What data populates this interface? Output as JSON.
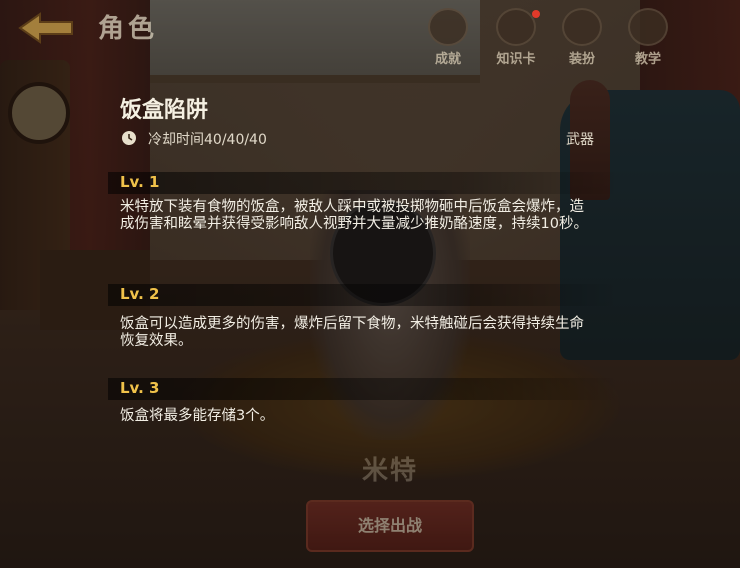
{
  "header": {
    "title": "角色",
    "buttons": [
      {
        "label": "成就",
        "icon": "trophy-icon"
      },
      {
        "label": "知识卡",
        "icon": "card-icon",
        "badge": true
      },
      {
        "label": "装扮",
        "icon": "outfit-icon"
      },
      {
        "label": "教学",
        "icon": "book-icon"
      }
    ]
  },
  "skill": {
    "name": "饭盒陷阱",
    "cooldown": "冷却时间40/40/40",
    "type": "武器",
    "levels": [
      {
        "label": "Lv. 1",
        "desc": "米特放下装有食物的饭盒，被敌人踩中或被投掷物砸中后饭盒会爆炸，造成伤害和眩晕并获得受影响敌人视野并大量减少推奶酪速度，持续10秒。"
      },
      {
        "label": "Lv. 2",
        "desc": "饭盒可以造成更多的伤害，爆炸后留下食物，米特触碰后会获得持续生命恢复效果。"
      },
      {
        "label": "Lv. 3",
        "desc": "饭盒将最多能存储3个。"
      }
    ]
  },
  "character": {
    "name": "米特"
  },
  "action": {
    "select_label": "选择出战"
  },
  "colors": {
    "level_text": "#f0c24a",
    "badge": "#e23a2a"
  }
}
